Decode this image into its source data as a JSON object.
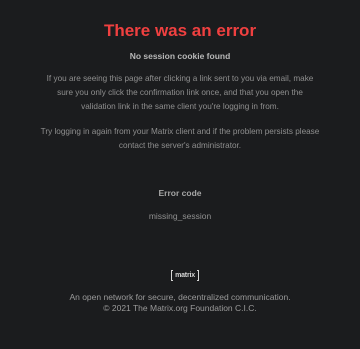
{
  "error_page": {
    "title": "There was an error",
    "subtitle": "No session cookie found",
    "paragraphs": [
      "If you are seeing this page after clicking a link sent to you via email, make sure you only click the confirmation link once, and that you open the validation link in the same client you're logging in from.",
      "Try logging in again from your Matrix client and if the problem persists please contact the server's administrator."
    ],
    "error_code_label": "Error code",
    "error_code_value": "missing_session"
  },
  "footer": {
    "logo_text": "matrix",
    "tagline": "An open network for secure, decentralized communication.",
    "copyright": "© 2021 The Matrix.org Foundation C.I.C."
  },
  "colors": {
    "background": "#1b1c1e",
    "title": "#f04040",
    "text": "#9a9a9a"
  }
}
